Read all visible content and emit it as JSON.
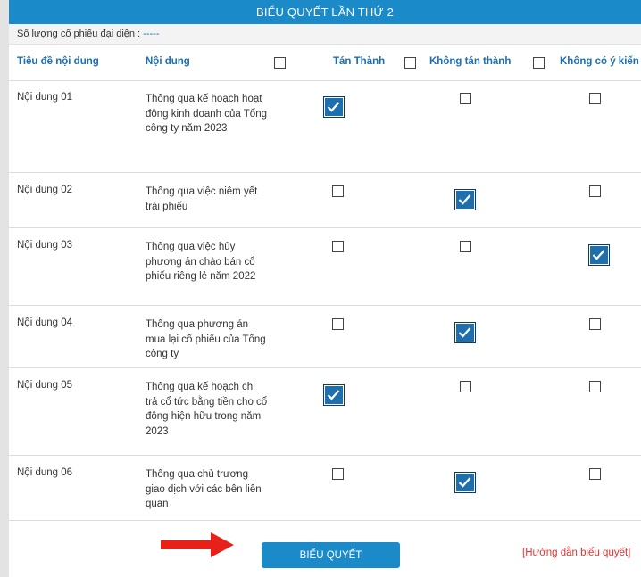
{
  "form": {
    "title": "BIỂU QUYẾT LẦN THỨ 2",
    "shares_label": "Số lượng cổ phiếu đại diện : ",
    "shares_value": "-----"
  },
  "headers": {
    "item_title": "Tiêu đề nội dung",
    "content": "Nội dung",
    "approve": "Tán Thành",
    "disapprove": "Không tán thành",
    "no_opinion": "Không có ý kiến"
  },
  "rows": [
    {
      "title": "Nội dung 01",
      "content": "Thông qua kế hoạch hoạt động kinh doanh của Tổng công ty năm 2023",
      "choice": "approve"
    },
    {
      "title": "Nội dung 02",
      "content": "Thông qua việc niêm yết trái phiếu",
      "choice": "disapprove"
    },
    {
      "title": "Nội dung 03",
      "content": "Thông qua việc hủy phương án chào bán cổ phiếu riêng lẻ năm 2022",
      "choice": "no_opinion"
    },
    {
      "title": "Nội dung 04",
      "content": "Thông qua phương án mua lại cổ phiếu của Tổng công ty",
      "choice": "disapprove"
    },
    {
      "title": "Nội dung 05",
      "content": "Thông qua kế hoạch chi trả cổ tức bằng tiền cho cổ đông hiện hữu trong năm 2023",
      "choice": "approve"
    },
    {
      "title": "Nội dung 06",
      "content": "Thông qua chủ trương giao dịch với các bên liên quan",
      "choice": "disapprove"
    }
  ],
  "footer": {
    "vote_button": "BIỂU QUYẾT",
    "guide_link": "[Hướng dẫn biểu quyết]"
  },
  "colors": {
    "header_bar": "#1a8ac9",
    "header_text": "#1a6fb6",
    "checked_fill": "#1e6fae",
    "guide_link": "#e3322f",
    "arrow": "#e8201a"
  },
  "icons": {
    "checkmark": "check-icon",
    "arrow": "arrow-right-icon"
  }
}
